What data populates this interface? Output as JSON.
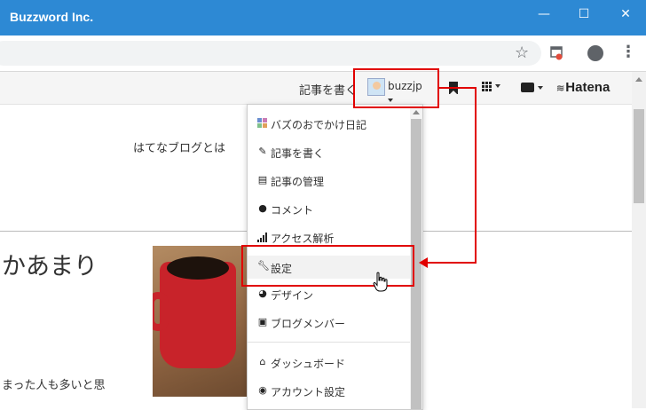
{
  "window": {
    "title": "Buzzword Inc.",
    "minimize": "—",
    "maximize": "☐",
    "close": "✕"
  },
  "toolbar": {
    "star_icon": "star-icon",
    "extension_icon": "extension-icon",
    "profile_icon": "profile-icon",
    "menu_icon": "kebab-menu-icon"
  },
  "hatena_bar": {
    "write_label": "記事を書く",
    "username": "buzzjp",
    "brand": "Hatena"
  },
  "page": {
    "about": "はてなブログとは",
    "headline": "かあまり",
    "excerpt": "まった人も多いと思"
  },
  "dropdown": {
    "items": [
      {
        "label": "バズのおでかけ日記",
        "icon": "blog-icon"
      },
      {
        "label": "記事を書く",
        "icon": "edit-icon"
      },
      {
        "label": "記事の管理",
        "icon": "document-icon"
      },
      {
        "label": "コメント",
        "icon": "comment-icon"
      },
      {
        "label": "アクセス解析",
        "icon": "signal-icon"
      },
      {
        "label": "設定",
        "icon": "wrench-icon"
      },
      {
        "label": "デザイン",
        "icon": "palette-icon"
      },
      {
        "label": "ブログメンバー",
        "icon": "member-icon"
      },
      {
        "label": "ダッシュボード",
        "icon": "home-icon"
      },
      {
        "label": "アカウント設定",
        "icon": "account-icon"
      }
    ],
    "highlighted_index": 5
  },
  "colors": {
    "titlebar": "#2d89d4",
    "annotation": "#e10000"
  }
}
